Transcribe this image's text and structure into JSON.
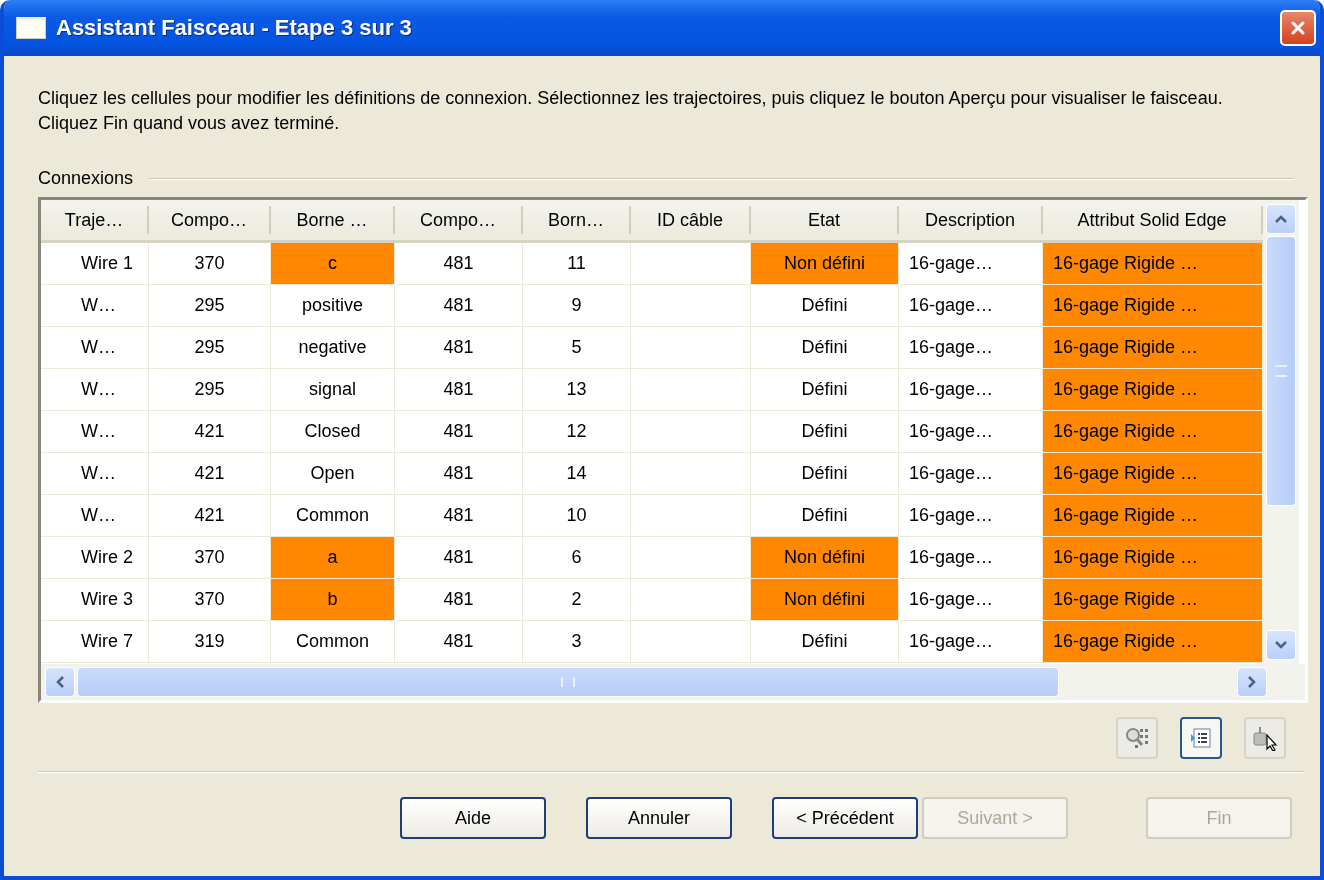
{
  "window": {
    "title": "Assistant Faisceau - Etape 3 sur 3"
  },
  "instructions": "Cliquez les cellules pour modifier les définitions de connexion. Sélectionnez les trajectoires, puis cliquez le bouton Aperçu pour visualiser le faisceau. Cliquez Fin quand vous avez terminé.",
  "group": {
    "label": "Connexions"
  },
  "table": {
    "columns": [
      "Traje…",
      "Compo…",
      "Borne …",
      "Compo…",
      "Born…",
      "ID câble",
      "Etat",
      "Description",
      "Attribut Solid Edge"
    ],
    "rows": [
      {
        "cells": [
          {
            "text": "Wire 1",
            "flagged": false
          },
          {
            "text": "370",
            "flagged": false
          },
          {
            "text": "c",
            "flagged": true
          },
          {
            "text": "481",
            "flagged": false
          },
          {
            "text": "11",
            "flagged": false
          },
          {
            "text": "",
            "flagged": false
          },
          {
            "text": "Non défini",
            "flagged": true
          },
          {
            "text": "16-gage…",
            "flagged": false
          },
          {
            "text": "16-gage Rigide …",
            "flagged": true
          }
        ]
      },
      {
        "cells": [
          {
            "text": "W…",
            "flagged": false
          },
          {
            "text": "295",
            "flagged": false
          },
          {
            "text": "positive",
            "flagged": false
          },
          {
            "text": "481",
            "flagged": false
          },
          {
            "text": "9",
            "flagged": false
          },
          {
            "text": "",
            "flagged": false
          },
          {
            "text": "Défini",
            "flagged": false
          },
          {
            "text": "16-gage…",
            "flagged": false
          },
          {
            "text": "16-gage Rigide …",
            "flagged": true
          }
        ]
      },
      {
        "cells": [
          {
            "text": "W…",
            "flagged": false
          },
          {
            "text": "295",
            "flagged": false
          },
          {
            "text": "negative",
            "flagged": false
          },
          {
            "text": "481",
            "flagged": false
          },
          {
            "text": "5",
            "flagged": false
          },
          {
            "text": "",
            "flagged": false
          },
          {
            "text": "Défini",
            "flagged": false
          },
          {
            "text": "16-gage…",
            "flagged": false
          },
          {
            "text": "16-gage Rigide …",
            "flagged": true
          }
        ]
      },
      {
        "cells": [
          {
            "text": "W…",
            "flagged": false
          },
          {
            "text": "295",
            "flagged": false
          },
          {
            "text": "signal",
            "flagged": false
          },
          {
            "text": "481",
            "flagged": false
          },
          {
            "text": "13",
            "flagged": false
          },
          {
            "text": "",
            "flagged": false
          },
          {
            "text": "Défini",
            "flagged": false
          },
          {
            "text": "16-gage…",
            "flagged": false
          },
          {
            "text": "16-gage Rigide …",
            "flagged": true
          }
        ]
      },
      {
        "cells": [
          {
            "text": "W…",
            "flagged": false
          },
          {
            "text": "421",
            "flagged": false
          },
          {
            "text": "Closed",
            "flagged": false
          },
          {
            "text": "481",
            "flagged": false
          },
          {
            "text": "12",
            "flagged": false
          },
          {
            "text": "",
            "flagged": false
          },
          {
            "text": "Défini",
            "flagged": false
          },
          {
            "text": "16-gage…",
            "flagged": false
          },
          {
            "text": "16-gage Rigide …",
            "flagged": true
          }
        ]
      },
      {
        "cells": [
          {
            "text": "W…",
            "flagged": false
          },
          {
            "text": "421",
            "flagged": false
          },
          {
            "text": "Open",
            "flagged": false
          },
          {
            "text": "481",
            "flagged": false
          },
          {
            "text": "14",
            "flagged": false
          },
          {
            "text": "",
            "flagged": false
          },
          {
            "text": "Défini",
            "flagged": false
          },
          {
            "text": "16-gage…",
            "flagged": false
          },
          {
            "text": "16-gage Rigide …",
            "flagged": true
          }
        ]
      },
      {
        "cells": [
          {
            "text": "W…",
            "flagged": false
          },
          {
            "text": "421",
            "flagged": false
          },
          {
            "text": "Common",
            "flagged": false
          },
          {
            "text": "481",
            "flagged": false
          },
          {
            "text": "10",
            "flagged": false
          },
          {
            "text": "",
            "flagged": false
          },
          {
            "text": "Défini",
            "flagged": false
          },
          {
            "text": "16-gage…",
            "flagged": false
          },
          {
            "text": "16-gage Rigide …",
            "flagged": true
          }
        ]
      },
      {
        "cells": [
          {
            "text": "Wire 2",
            "flagged": false
          },
          {
            "text": "370",
            "flagged": false
          },
          {
            "text": "a",
            "flagged": true
          },
          {
            "text": "481",
            "flagged": false
          },
          {
            "text": "6",
            "flagged": false
          },
          {
            "text": "",
            "flagged": false
          },
          {
            "text": "Non défini",
            "flagged": true
          },
          {
            "text": "16-gage…",
            "flagged": false
          },
          {
            "text": "16-gage Rigide …",
            "flagged": true
          }
        ]
      },
      {
        "cells": [
          {
            "text": "Wire 3",
            "flagged": false
          },
          {
            "text": "370",
            "flagged": false
          },
          {
            "text": "b",
            "flagged": true
          },
          {
            "text": "481",
            "flagged": false
          },
          {
            "text": "2",
            "flagged": false
          },
          {
            "text": "",
            "flagged": false
          },
          {
            "text": "Non défini",
            "flagged": true
          },
          {
            "text": "16-gage…",
            "flagged": false
          },
          {
            "text": "16-gage Rigide …",
            "flagged": true
          }
        ]
      },
      {
        "cells": [
          {
            "text": "Wire 7",
            "flagged": false
          },
          {
            "text": "319",
            "flagged": false
          },
          {
            "text": "Common",
            "flagged": false
          },
          {
            "text": "481",
            "flagged": false
          },
          {
            "text": "3",
            "flagged": false
          },
          {
            "text": "",
            "flagged": false
          },
          {
            "text": "Défini",
            "flagged": false
          },
          {
            "text": "16-gage…",
            "flagged": false
          },
          {
            "text": "16-gage Rigide …",
            "flagged": true
          }
        ]
      }
    ]
  },
  "view_buttons": [
    {
      "selected": false
    },
    {
      "selected": true
    },
    {
      "selected": false
    }
  ],
  "buttons": [
    {
      "label": "Aide",
      "disabled": false
    },
    {
      "label": "Annuler",
      "disabled": false
    },
    {
      "label": "< Précédent",
      "disabled": false
    },
    {
      "label": "Suivant >",
      "disabled": true
    },
    {
      "label": "Fin",
      "disabled": true
    }
  ]
}
